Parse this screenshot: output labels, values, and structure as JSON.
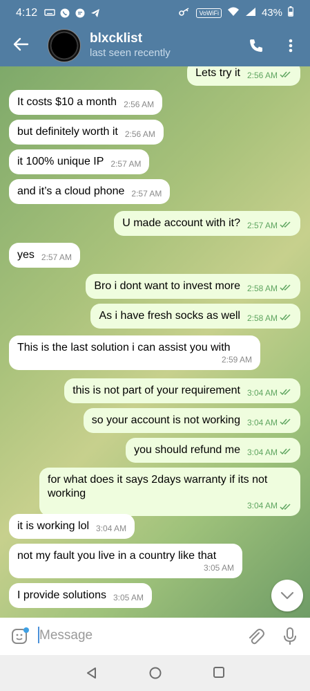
{
  "status_bar": {
    "time": "4:12",
    "vowifi": "VoWiFi",
    "battery": "43%"
  },
  "header": {
    "title": "blxcklist",
    "subtitle": "last seen recently"
  },
  "messages": [
    {
      "dir": "out",
      "text": "Lets try it",
      "time": "2:56 AM"
    },
    {
      "dir": "in",
      "text": "It costs $10 a month",
      "time": "2:56 AM"
    },
    {
      "dir": "in",
      "text": "but definitely worth it",
      "time": "2:56 AM"
    },
    {
      "dir": "in",
      "text": "it 100% unique IP",
      "time": "2:57 AM"
    },
    {
      "dir": "in",
      "text": "and it’s a cloud phone",
      "time": "2:57 AM"
    },
    {
      "dir": "out",
      "text": "U made account with it?",
      "time": "2:57 AM"
    },
    {
      "dir": "in",
      "text": "yes",
      "time": "2:57 AM"
    },
    {
      "dir": "out",
      "text": "Bro i dont want to invest more",
      "time": "2:58 AM"
    },
    {
      "dir": "out",
      "text": "As i have fresh socks as well",
      "time": "2:58 AM"
    },
    {
      "dir": "in",
      "text": "This is the last solution i can assist you with",
      "time": "2:59 AM"
    },
    {
      "dir": "out",
      "text": "this is not part of your requirement",
      "time": "3:04 AM"
    },
    {
      "dir": "out",
      "text": "so your account is not working",
      "time": "3:04 AM"
    },
    {
      "dir": "out",
      "text": "you should refund me",
      "time": "3:04 AM"
    },
    {
      "dir": "out",
      "text": "for what does it says 2days warranty if its not working",
      "time": "3:04 AM"
    },
    {
      "dir": "in",
      "text": "it is working lol",
      "time": "3:04 AM"
    },
    {
      "dir": "in",
      "text": "not my fault you live in a country like that",
      "time": "3:05 AM"
    },
    {
      "dir": "in",
      "text": "I provide solutions",
      "time": "3:05 AM"
    }
  ],
  "composer": {
    "placeholder": "Message",
    "value": ""
  },
  "colors": {
    "header": "#517da2",
    "incoming_bubble": "#ffffff",
    "outgoing_bubble": "#effdde",
    "outgoing_time": "#5fa560"
  },
  "icons": [
    "back-arrow-icon",
    "phone-icon",
    "more-vertical-icon",
    "double-check-icon",
    "chevron-down-icon",
    "emoji-sticker-icon",
    "paperclip-icon",
    "microphone-icon",
    "nav-back-icon",
    "nav-home-icon",
    "nav-recents-icon"
  ]
}
